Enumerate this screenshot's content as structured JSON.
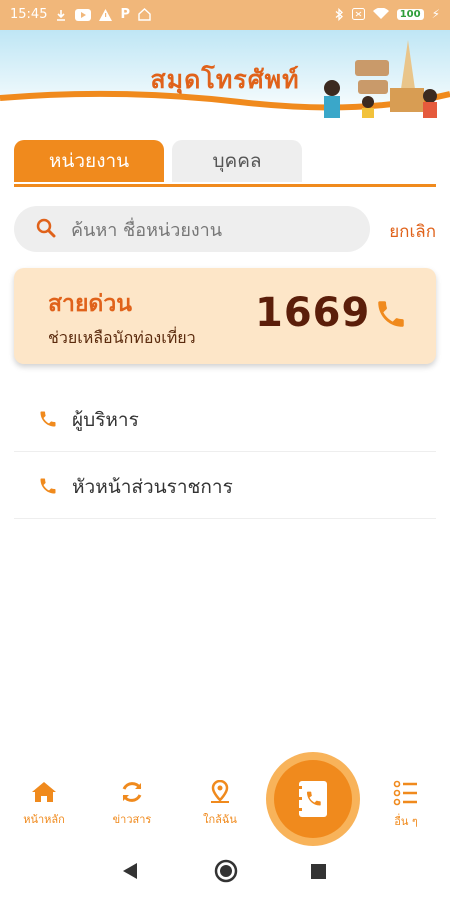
{
  "status_bar": {
    "time": "15:45",
    "battery": "100"
  },
  "header": {
    "title": "สมุดโทรศัพท์"
  },
  "tabs": [
    {
      "label": "หน่วยงาน",
      "active": true
    },
    {
      "label": "บุคคล",
      "active": false
    }
  ],
  "search": {
    "placeholder": "ค้นหา ชื่อหน่วยงาน",
    "cancel_label": "ยกเลิก"
  },
  "hotline": {
    "title": "สายด่วน",
    "subtitle": "ช่วยเหลือนักท่องเที่ยว",
    "number": "1669"
  },
  "list": [
    {
      "label": "ผู้บริหาร"
    },
    {
      "label": "หัวหน้าส่วนราชการ"
    }
  ],
  "bottom_nav": [
    {
      "label": "หน้าหลัก",
      "icon": "home-icon"
    },
    {
      "label": "ข่าวสาร",
      "icon": "refresh-icon"
    },
    {
      "label": "ใกล้ฉัน",
      "icon": "location-pin-icon"
    },
    {
      "label": "",
      "icon": "phonebook-icon"
    },
    {
      "label": "อื่น ๆ",
      "icon": "list-icon"
    }
  ],
  "colors": {
    "accent": "#f08a1d",
    "title": "#e0621a",
    "hotline_bg": "#fde6c8",
    "number": "#5b1e0a"
  }
}
